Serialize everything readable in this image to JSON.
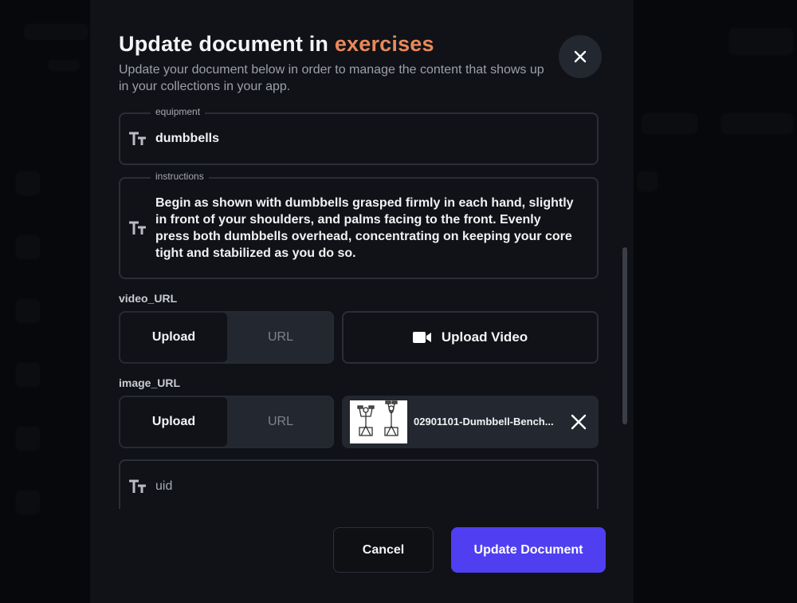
{
  "modal": {
    "title_prefix": "Update document in",
    "title_collection": "exercises",
    "subtitle": "Update your document below in order to manage the content that shows up in your collections in your app.",
    "close_icon": "close-icon"
  },
  "fields": {
    "equipment": {
      "label": "equipment",
      "value": "dumbbells",
      "icon": "text-type-icon"
    },
    "instructions": {
      "label": "instructions",
      "value": "Begin as shown with dumbbells grasped firmly in each hand, slightly in front of your shoulders, and palms facing to the front. Evenly press both dumbbells overhead, concentrating on keeping your core tight and stabilized as you do so.",
      "icon": "text-type-icon"
    },
    "video_url": {
      "label": "video_URL",
      "toggle": {
        "upload": "Upload",
        "url": "URL",
        "selected": "Upload"
      },
      "upload_button": "Upload Video",
      "upload_icon": "video-camera-icon"
    },
    "image_url": {
      "label": "image_URL",
      "toggle": {
        "upload": "Upload",
        "url": "URL",
        "selected": "Upload"
      },
      "file_name": "02901101-Dumbbell-Bench...",
      "remove_icon": "close-icon"
    },
    "uid": {
      "placeholder": "uid",
      "icon": "text-type-icon"
    }
  },
  "actions": {
    "cancel": "Cancel",
    "update": "Update Document"
  },
  "colors": {
    "accent": "#e8895a",
    "primary_button": "#4f3ff0",
    "modal_bg": "#101217"
  }
}
